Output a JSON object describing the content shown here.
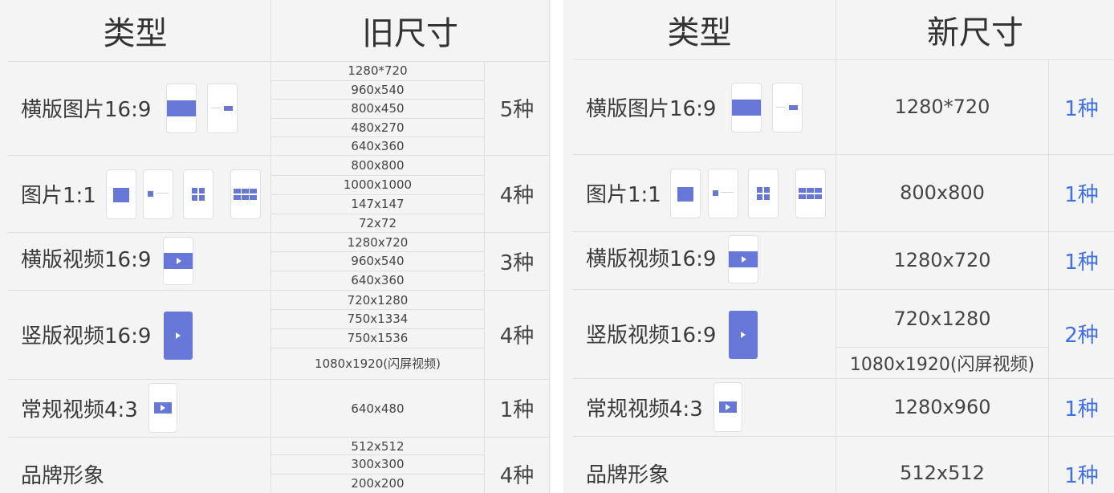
{
  "left": {
    "header_type": "类型",
    "header_size": "旧尺寸",
    "rows": [
      {
        "type": "横版图片16:9",
        "sizes": [
          "1280*720",
          "960x540",
          "800x450",
          "480x270",
          "640x360"
        ],
        "count": "5种"
      },
      {
        "type": "图片1:1",
        "sizes": [
          "800x800",
          "1000x1000",
          "147x147",
          "72x72"
        ],
        "count": "4种"
      },
      {
        "type": "横版视频16:9",
        "sizes": [
          "1280x720",
          "960x540",
          "640x360"
        ],
        "count": "3种"
      },
      {
        "type": "竖版视频16:9",
        "sizes": [
          "720x1280",
          "750x1334",
          "750x1536",
          "1080x1920(闪屏视频)"
        ],
        "count": "4种"
      },
      {
        "type": "常规视频4:3",
        "sizes": [
          "640x480"
        ],
        "count": "1种"
      },
      {
        "type": "品牌形象",
        "sizes": [
          "512x512",
          "300x300",
          "200x200"
        ],
        "count": "4种"
      }
    ]
  },
  "right": {
    "header_type": "类型",
    "header_size": "新尺寸",
    "rows": [
      {
        "type": "横版图片16:9",
        "sizes": [
          "1280*720"
        ],
        "count": "1种"
      },
      {
        "type": "图片1:1",
        "sizes": [
          "800x800"
        ],
        "count": "1种"
      },
      {
        "type": "横版视频16:9",
        "sizes": [
          "1280x720"
        ],
        "count": "1种"
      },
      {
        "type": "竖版视频16:9",
        "sizes": [
          "720x1280",
          "1080x1920(闪屏视频)"
        ],
        "count": "2种"
      },
      {
        "type": "常规视频4:3",
        "sizes": [
          "1280x960"
        ],
        "count": "1种"
      },
      {
        "type": "品牌形象",
        "sizes": [
          "512x512"
        ],
        "count": "1种"
      }
    ]
  },
  "colors": {
    "panel_bg": "#f4f4f4",
    "grid_line": "#dedede",
    "icon_fill": "#6777d8",
    "count_new": "#3f6ee9"
  },
  "icons": [
    "landscape-image-icon",
    "square-image-icon",
    "grid-image-icon",
    "landscape-video-icon",
    "portrait-video-icon",
    "standard-video-icon"
  ]
}
